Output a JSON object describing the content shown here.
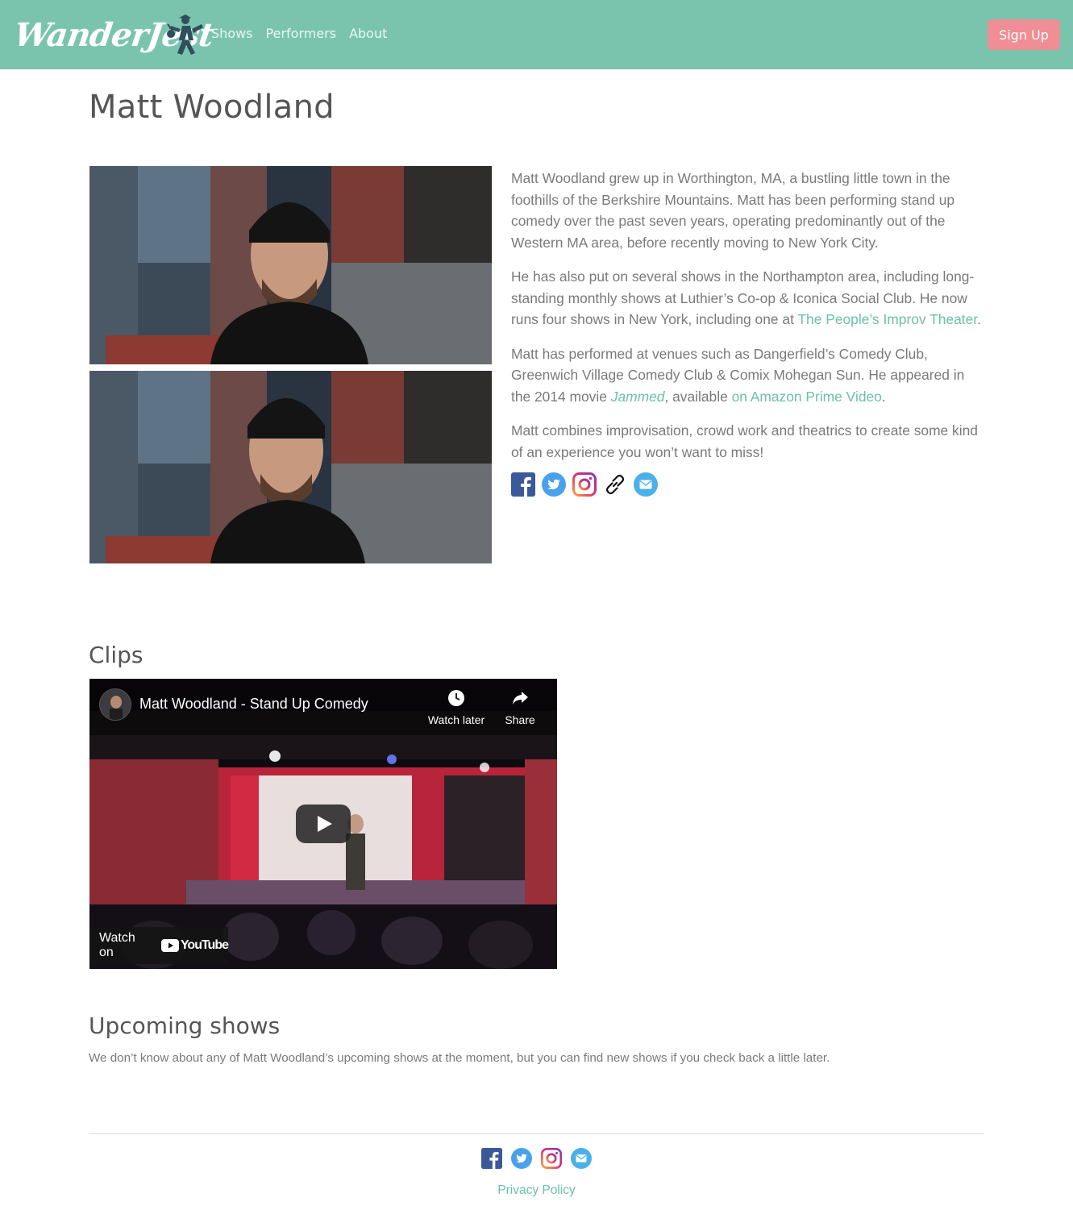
{
  "header": {
    "logo_text": "WanderJest",
    "nav": [
      "Shows",
      "Performers",
      "About"
    ],
    "signup_label": "Sign Up"
  },
  "performer": {
    "name": "Matt Woodland"
  },
  "bio": {
    "p1": "Matt Woodland grew up in Worthington, MA, a bustling little town in the foothills of the Berkshire Mountains. Matt has been performing stand up comedy over the past seven years, operating predominantly out of the Western MA area, before recently moving to New York City.",
    "p2_before": "He has also put on several shows in the Northampton area, including long-standing monthly shows at Luthier’s Co-op & Iconica Social Club. He now runs four shows in New York, including one at ",
    "p2_link": "The People’s Improv Theater",
    "p2_after": ".",
    "p3_before": "Matt has performed at venues such as Dangerfield’s Comedy Club, Greenwich Village Comedy Club & Comix Mohegan Sun. He appeared in the 2014 movie ",
    "p3_movie": "Jammed",
    "p3_middle": ", available ",
    "p3_link": "on Amazon Prime Video",
    "p3_after": ".",
    "p4": "Matt combines improvisation, crowd work and theatrics to create some kind of an experience you won’t want to miss!"
  },
  "social_icons": [
    "facebook-icon",
    "twitter-icon",
    "instagram-icon",
    "link-icon",
    "email-icon"
  ],
  "clips": {
    "heading": "Clips",
    "video_title": "Matt Woodland - Stand Up Comedy",
    "watch_later": "Watch later",
    "share": "Share",
    "watch_on": "Watch on",
    "youtube": "YouTube"
  },
  "upcoming": {
    "heading": "Upcoming shows",
    "message": "We don’t know about any of Matt Woodland’s upcoming shows at the moment, but you can find new shows if you check back a little later."
  },
  "footer": {
    "social_icons": [
      "facebook-icon",
      "twitter-icon",
      "instagram-icon",
      "email-icon"
    ],
    "privacy": "Privacy Policy"
  },
  "colors": {
    "header_bg": "#7ac4ae",
    "signup_bg": "#ef8e94",
    "link": "#6cc0a8",
    "text": "#7a7a7a",
    "heading": "#555555"
  }
}
